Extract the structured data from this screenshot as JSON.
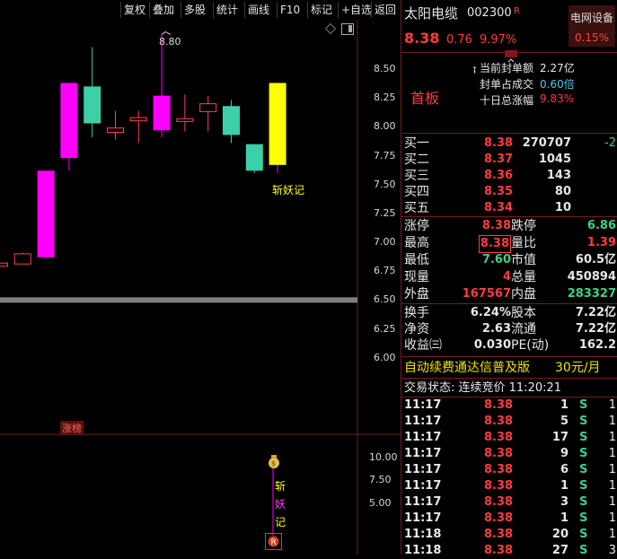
{
  "toolbar": {
    "buttons": [
      "复权",
      "叠加",
      "多股",
      "统计",
      "画线",
      "F10",
      "标记",
      "+自选",
      "返回"
    ]
  },
  "chart": {
    "peak_label": "8.80",
    "annotation": "斩妖记",
    "tag_label": "涨榜",
    "y_ticks": [
      "8.50",
      "8.25",
      "8.00",
      "7.75",
      "7.50",
      "7.25",
      "7.00",
      "6.75",
      "6.50",
      "6.25",
      "6.00"
    ],
    "lower_ticks": [
      "10.00",
      "7.50",
      "5.00"
    ],
    "lower_vert_text": [
      "斩",
      "妖",
      "记"
    ],
    "colors": {
      "up_bar": "#ff00ff",
      "teal_bar": "#3cd0a8",
      "yellow_bar": "#ffff00",
      "band": "#808080"
    }
  },
  "chart_data": {
    "type": "candlestick",
    "y_range": [
      5.85,
      8.85
    ],
    "candles": [
      {
        "open": 6.8,
        "close": 6.82,
        "high": 6.83,
        "low": 6.79
      },
      {
        "open": 6.82,
        "close": 6.9,
        "high": 6.91,
        "low": 6.81
      },
      {
        "open": 6.87,
        "close": 7.62,
        "high": 7.62,
        "low": 6.86
      },
      {
        "open": 7.73,
        "close": 8.38,
        "high": 8.38,
        "low": 7.62
      },
      {
        "open": 8.35,
        "close": 8.03,
        "high": 8.69,
        "low": 7.91
      },
      {
        "open": 7.96,
        "close": 7.99,
        "high": 8.14,
        "low": 7.89
      },
      {
        "open": 8.06,
        "close": 8.08,
        "high": 8.14,
        "low": 7.86
      },
      {
        "open": 7.97,
        "close": 8.27,
        "high": 8.8,
        "low": 7.91
      },
      {
        "open": 8.07,
        "close": 8.07,
        "high": 8.28,
        "low": 7.96
      },
      {
        "open": 8.14,
        "close": 8.2,
        "high": 8.27,
        "low": 7.96
      },
      {
        "open": 8.18,
        "close": 7.93,
        "high": 8.23,
        "low": 7.86
      },
      {
        "open": 7.85,
        "close": 7.62,
        "high": 7.85,
        "low": 7.6
      },
      {
        "open": 7.67,
        "close": 8.38,
        "high": 8.38,
        "low": 7.6
      }
    ]
  },
  "stock": {
    "name": "太阳电缆",
    "code": "002300",
    "badge": "R",
    "price": "8.38",
    "change": "0.76",
    "pct": "9.97%",
    "sector": "电网设备",
    "sector_pct": "0.15%",
    "board": "首板",
    "seal_amount_label": "当前封单额",
    "seal_amount": "2.27亿",
    "seal_ratio_label": "封单占成交",
    "seal_ratio": "0.60倍",
    "ten_day_label": "十日总涨幅",
    "ten_day": "9.83%"
  },
  "bids": [
    {
      "label": "买一",
      "price": "8.38",
      "vol": "270707",
      "chg": "-2"
    },
    {
      "label": "买二",
      "price": "8.37",
      "vol": "1045",
      "chg": ""
    },
    {
      "label": "买三",
      "price": "8.36",
      "vol": "143",
      "chg": ""
    },
    {
      "label": "买四",
      "price": "8.35",
      "vol": "80",
      "chg": ""
    },
    {
      "label": "买五",
      "price": "8.34",
      "vol": "10",
      "chg": ""
    }
  ],
  "stats": [
    {
      "l1": "涨停",
      "v1": "8.38",
      "l2": "跌停",
      "v2": "6.86"
    },
    {
      "l1": "最高",
      "v1": "8.38",
      "l2": "量比",
      "v2": "1.39"
    },
    {
      "l1": "最低",
      "v1": "7.60",
      "l2": "市值",
      "v2": "60.5亿"
    },
    {
      "l1": "现量",
      "v1": "4",
      "l2": "总量",
      "v2": "450894"
    },
    {
      "l1": "外盘",
      "v1": "167567",
      "l2": "内盘",
      "v2": "283327"
    }
  ],
  "fin": [
    {
      "l1": "换手",
      "v1": "6.24%",
      "l2": "股本",
      "v2": "7.22亿"
    },
    {
      "l1": "净资",
      "v1": "2.63",
      "l2": "流通",
      "v2": "7.22亿"
    },
    {
      "l1": "收益㈢",
      "v1": "0.030",
      "l2": "PE(动)",
      "v2": "162.2"
    }
  ],
  "promo": {
    "text": "自动续费通达信普及版",
    "price": "30元/月"
  },
  "trade_status": "交易状态: 连续竞价 11:20:21",
  "ticks": [
    {
      "time": "11:17",
      "price": "8.38",
      "vol": "1",
      "side": "S",
      "n": "1"
    },
    {
      "time": "11:17",
      "price": "8.38",
      "vol": "5",
      "side": "S",
      "n": "1"
    },
    {
      "time": "11:17",
      "price": "8.38",
      "vol": "17",
      "side": "S",
      "n": "1"
    },
    {
      "time": "11:17",
      "price": "8.38",
      "vol": "9",
      "side": "S",
      "n": "1"
    },
    {
      "time": "11:17",
      "price": "8.38",
      "vol": "6",
      "side": "S",
      "n": "1"
    },
    {
      "time": "11:17",
      "price": "8.38",
      "vol": "1",
      "side": "S",
      "n": "1"
    },
    {
      "time": "11:17",
      "price": "8.38",
      "vol": "3",
      "side": "S",
      "n": "1"
    },
    {
      "time": "11:17",
      "price": "8.38",
      "vol": "1",
      "side": "S",
      "n": "1"
    },
    {
      "time": "11:18",
      "price": "8.38",
      "vol": "20",
      "side": "S",
      "n": "1"
    },
    {
      "time": "11:18",
      "price": "8.38",
      "vol": "27",
      "side": "S",
      "n": "3"
    }
  ]
}
